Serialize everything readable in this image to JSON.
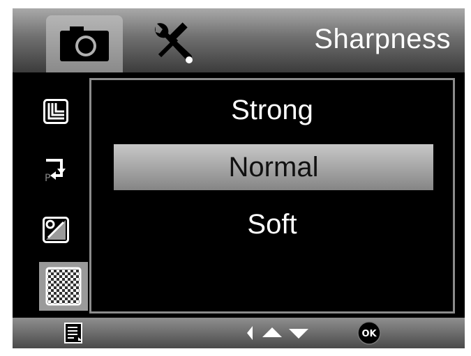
{
  "header": {
    "title": "Sharpness",
    "tabs": [
      {
        "icon": "camera-icon",
        "active": true
      },
      {
        "icon": "tools-icon",
        "active": false
      }
    ]
  },
  "sidebar": {
    "items": [
      {
        "icon": "image-size-icon",
        "active": false
      },
      {
        "icon": "image-quality-icon",
        "active": false
      },
      {
        "icon": "exposure-icon",
        "active": false
      },
      {
        "icon": "sharpness-icon",
        "active": true
      }
    ]
  },
  "menu": {
    "options": [
      "Strong",
      "Normal",
      "Soft"
    ],
    "selected": "Normal"
  },
  "footer": {
    "menu_icon": "menu-list-icon",
    "nav_icons": [
      "arrow-left-icon",
      "arrow-up-icon",
      "arrow-down-icon"
    ],
    "ok_label": "OK"
  },
  "colors": {
    "background": "#000000",
    "selected_fill": "#a8a8a8",
    "text": "#ffffff"
  }
}
